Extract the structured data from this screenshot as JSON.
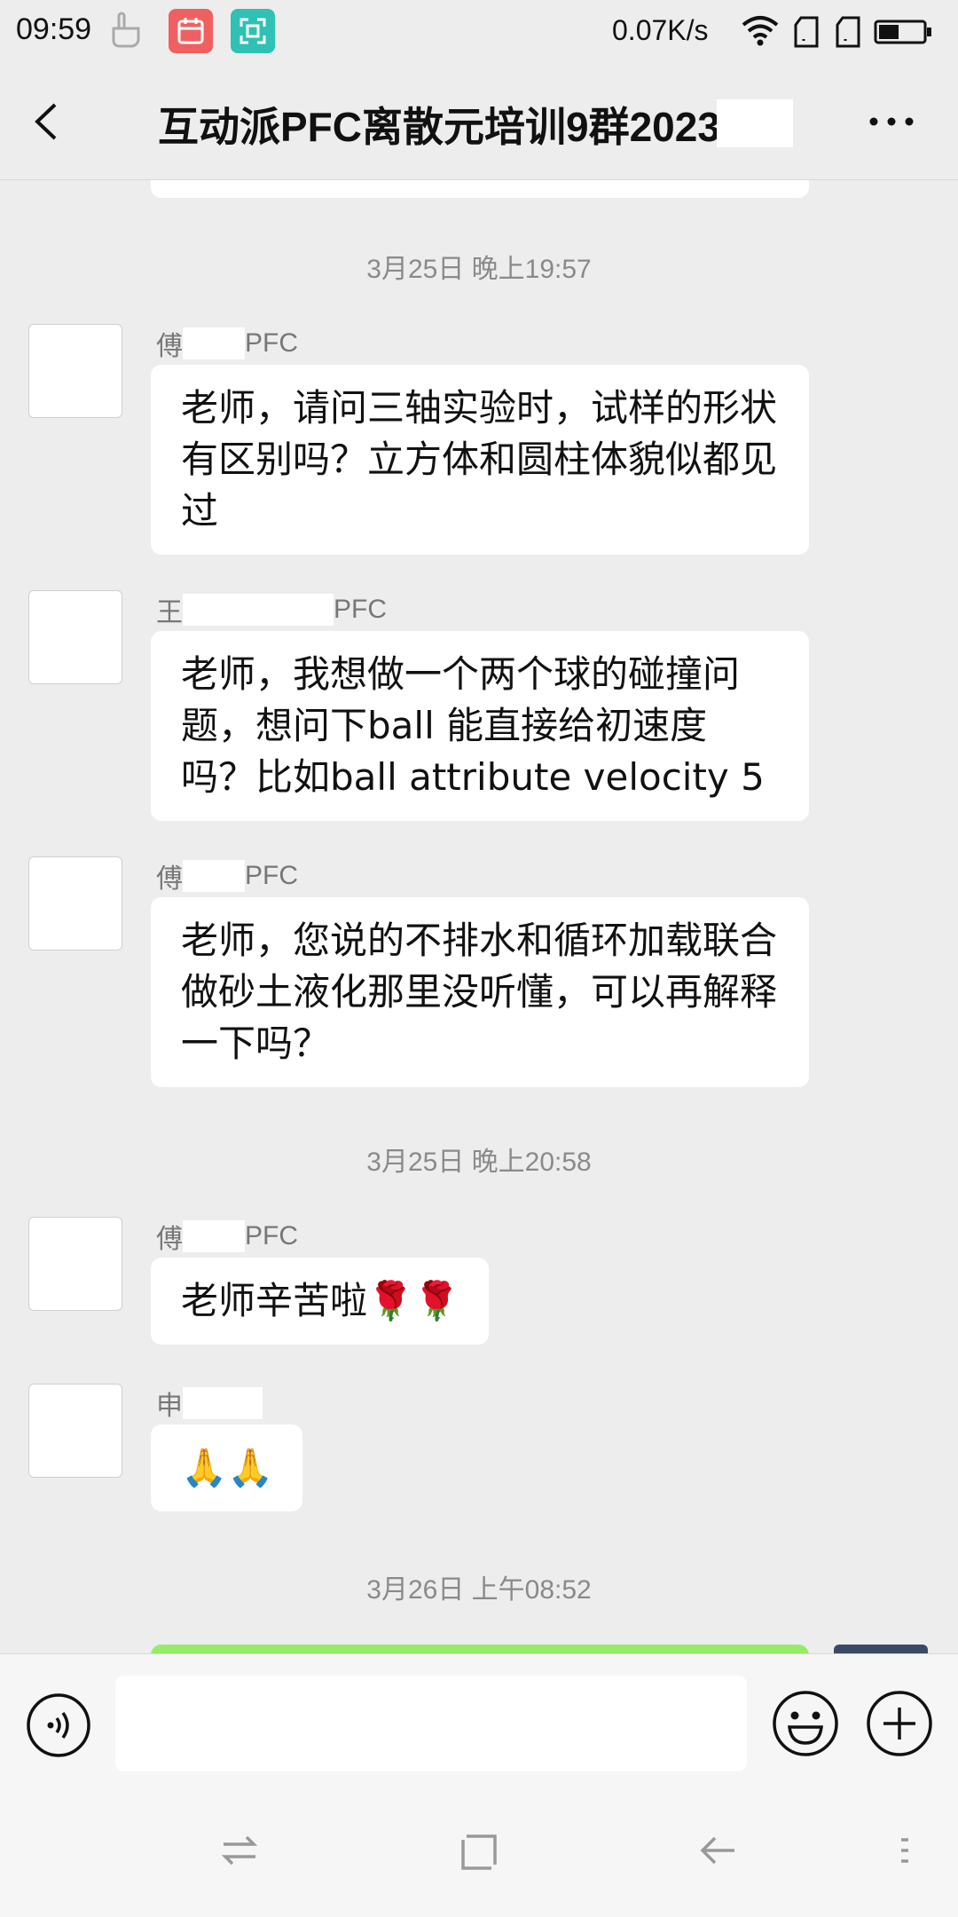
{
  "status_bar": {
    "time": "09:59",
    "net_speed": "0.07K/s",
    "icons": [
      "hand-icon",
      "calendar-icon",
      "screenshot-icon",
      "wifi-icon",
      "sim1-icon",
      "sim2-icon",
      "battery-icon"
    ]
  },
  "header": {
    "title": "互动派PFC离散元培训9群2023",
    "back_icon": "chevron-left-icon",
    "more_icon": "more-dots-icon"
  },
  "chat": {
    "timestamps": [
      "3月25日 晚上19:57",
      "3月25日 晚上20:58",
      "3月26日 上午08:52"
    ],
    "messages": [
      {
        "name_prefix": "傅",
        "name_suffix": "PFC",
        "text": "老师，请问三轴实验时，试样的形状有区别吗？立方体和圆柱体貌似都见过"
      },
      {
        "name_prefix": "王",
        "name_suffix": "PFC",
        "text": "老师，我想做一个两个球的碰撞问题，想问下ball 能直接给初速度吗？比如ball attribute velocity 5"
      },
      {
        "name_prefix": "傅",
        "name_suffix": "PFC",
        "text": "老师，您说的不排水和循环加载联合做砂土液化那里没听懂，可以再解释一下吗？"
      },
      {
        "name_prefix": "傅",
        "name_suffix": "PFC",
        "text": "老师辛苦啦🌹🌹"
      },
      {
        "name_prefix": "申",
        "name_suffix": "",
        "text": "🙏🙏"
      }
    ]
  },
  "input_bar": {
    "placeholder": "",
    "voice_icon": "voice-icon",
    "emoji_icon": "emoji-icon",
    "plus_icon": "plus-icon"
  },
  "nav_bar": {
    "icons": [
      "switch-icon",
      "home-icon",
      "back-icon",
      "menu-icon"
    ]
  },
  "colors": {
    "background": "#ededed",
    "bubble": "#ffffff",
    "self_bubble": "#95ec69",
    "timestamp": "#8a8a8a",
    "calendar_icon_bg": "#f06060",
    "scan_icon_bg": "#2fc1b3"
  }
}
